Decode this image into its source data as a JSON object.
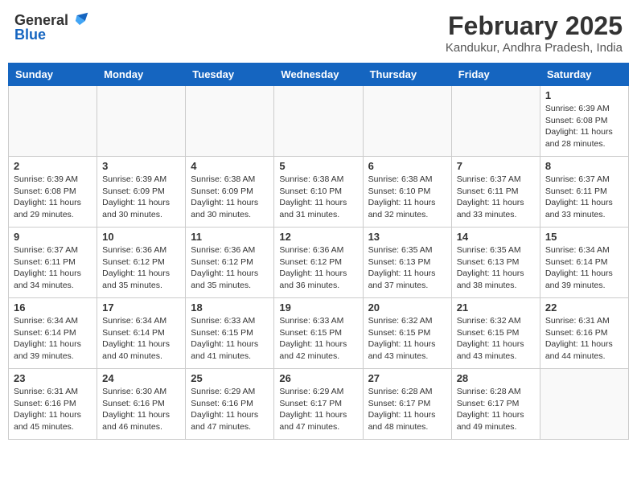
{
  "header": {
    "logo_general": "General",
    "logo_blue": "Blue",
    "title": "February 2025",
    "subtitle": "Kandukur, Andhra Pradesh, India"
  },
  "weekdays": [
    "Sunday",
    "Monday",
    "Tuesday",
    "Wednesday",
    "Thursday",
    "Friday",
    "Saturday"
  ],
  "weeks": [
    [
      {
        "day": "",
        "info": ""
      },
      {
        "day": "",
        "info": ""
      },
      {
        "day": "",
        "info": ""
      },
      {
        "day": "",
        "info": ""
      },
      {
        "day": "",
        "info": ""
      },
      {
        "day": "",
        "info": ""
      },
      {
        "day": "1",
        "info": "Sunrise: 6:39 AM\nSunset: 6:08 PM\nDaylight: 11 hours and 28 minutes."
      }
    ],
    [
      {
        "day": "2",
        "info": "Sunrise: 6:39 AM\nSunset: 6:08 PM\nDaylight: 11 hours and 29 minutes."
      },
      {
        "day": "3",
        "info": "Sunrise: 6:39 AM\nSunset: 6:09 PM\nDaylight: 11 hours and 30 minutes."
      },
      {
        "day": "4",
        "info": "Sunrise: 6:38 AM\nSunset: 6:09 PM\nDaylight: 11 hours and 30 minutes."
      },
      {
        "day": "5",
        "info": "Sunrise: 6:38 AM\nSunset: 6:10 PM\nDaylight: 11 hours and 31 minutes."
      },
      {
        "day": "6",
        "info": "Sunrise: 6:38 AM\nSunset: 6:10 PM\nDaylight: 11 hours and 32 minutes."
      },
      {
        "day": "7",
        "info": "Sunrise: 6:37 AM\nSunset: 6:11 PM\nDaylight: 11 hours and 33 minutes."
      },
      {
        "day": "8",
        "info": "Sunrise: 6:37 AM\nSunset: 6:11 PM\nDaylight: 11 hours and 33 minutes."
      }
    ],
    [
      {
        "day": "9",
        "info": "Sunrise: 6:37 AM\nSunset: 6:11 PM\nDaylight: 11 hours and 34 minutes."
      },
      {
        "day": "10",
        "info": "Sunrise: 6:36 AM\nSunset: 6:12 PM\nDaylight: 11 hours and 35 minutes."
      },
      {
        "day": "11",
        "info": "Sunrise: 6:36 AM\nSunset: 6:12 PM\nDaylight: 11 hours and 35 minutes."
      },
      {
        "day": "12",
        "info": "Sunrise: 6:36 AM\nSunset: 6:12 PM\nDaylight: 11 hours and 36 minutes."
      },
      {
        "day": "13",
        "info": "Sunrise: 6:35 AM\nSunset: 6:13 PM\nDaylight: 11 hours and 37 minutes."
      },
      {
        "day": "14",
        "info": "Sunrise: 6:35 AM\nSunset: 6:13 PM\nDaylight: 11 hours and 38 minutes."
      },
      {
        "day": "15",
        "info": "Sunrise: 6:34 AM\nSunset: 6:14 PM\nDaylight: 11 hours and 39 minutes."
      }
    ],
    [
      {
        "day": "16",
        "info": "Sunrise: 6:34 AM\nSunset: 6:14 PM\nDaylight: 11 hours and 39 minutes."
      },
      {
        "day": "17",
        "info": "Sunrise: 6:34 AM\nSunset: 6:14 PM\nDaylight: 11 hours and 40 minutes."
      },
      {
        "day": "18",
        "info": "Sunrise: 6:33 AM\nSunset: 6:15 PM\nDaylight: 11 hours and 41 minutes."
      },
      {
        "day": "19",
        "info": "Sunrise: 6:33 AM\nSunset: 6:15 PM\nDaylight: 11 hours and 42 minutes."
      },
      {
        "day": "20",
        "info": "Sunrise: 6:32 AM\nSunset: 6:15 PM\nDaylight: 11 hours and 43 minutes."
      },
      {
        "day": "21",
        "info": "Sunrise: 6:32 AM\nSunset: 6:15 PM\nDaylight: 11 hours and 43 minutes."
      },
      {
        "day": "22",
        "info": "Sunrise: 6:31 AM\nSunset: 6:16 PM\nDaylight: 11 hours and 44 minutes."
      }
    ],
    [
      {
        "day": "23",
        "info": "Sunrise: 6:31 AM\nSunset: 6:16 PM\nDaylight: 11 hours and 45 minutes."
      },
      {
        "day": "24",
        "info": "Sunrise: 6:30 AM\nSunset: 6:16 PM\nDaylight: 11 hours and 46 minutes."
      },
      {
        "day": "25",
        "info": "Sunrise: 6:29 AM\nSunset: 6:16 PM\nDaylight: 11 hours and 47 minutes."
      },
      {
        "day": "26",
        "info": "Sunrise: 6:29 AM\nSunset: 6:17 PM\nDaylight: 11 hours and 47 minutes."
      },
      {
        "day": "27",
        "info": "Sunrise: 6:28 AM\nSunset: 6:17 PM\nDaylight: 11 hours and 48 minutes."
      },
      {
        "day": "28",
        "info": "Sunrise: 6:28 AM\nSunset: 6:17 PM\nDaylight: 11 hours and 49 minutes."
      },
      {
        "day": "",
        "info": ""
      }
    ]
  ]
}
